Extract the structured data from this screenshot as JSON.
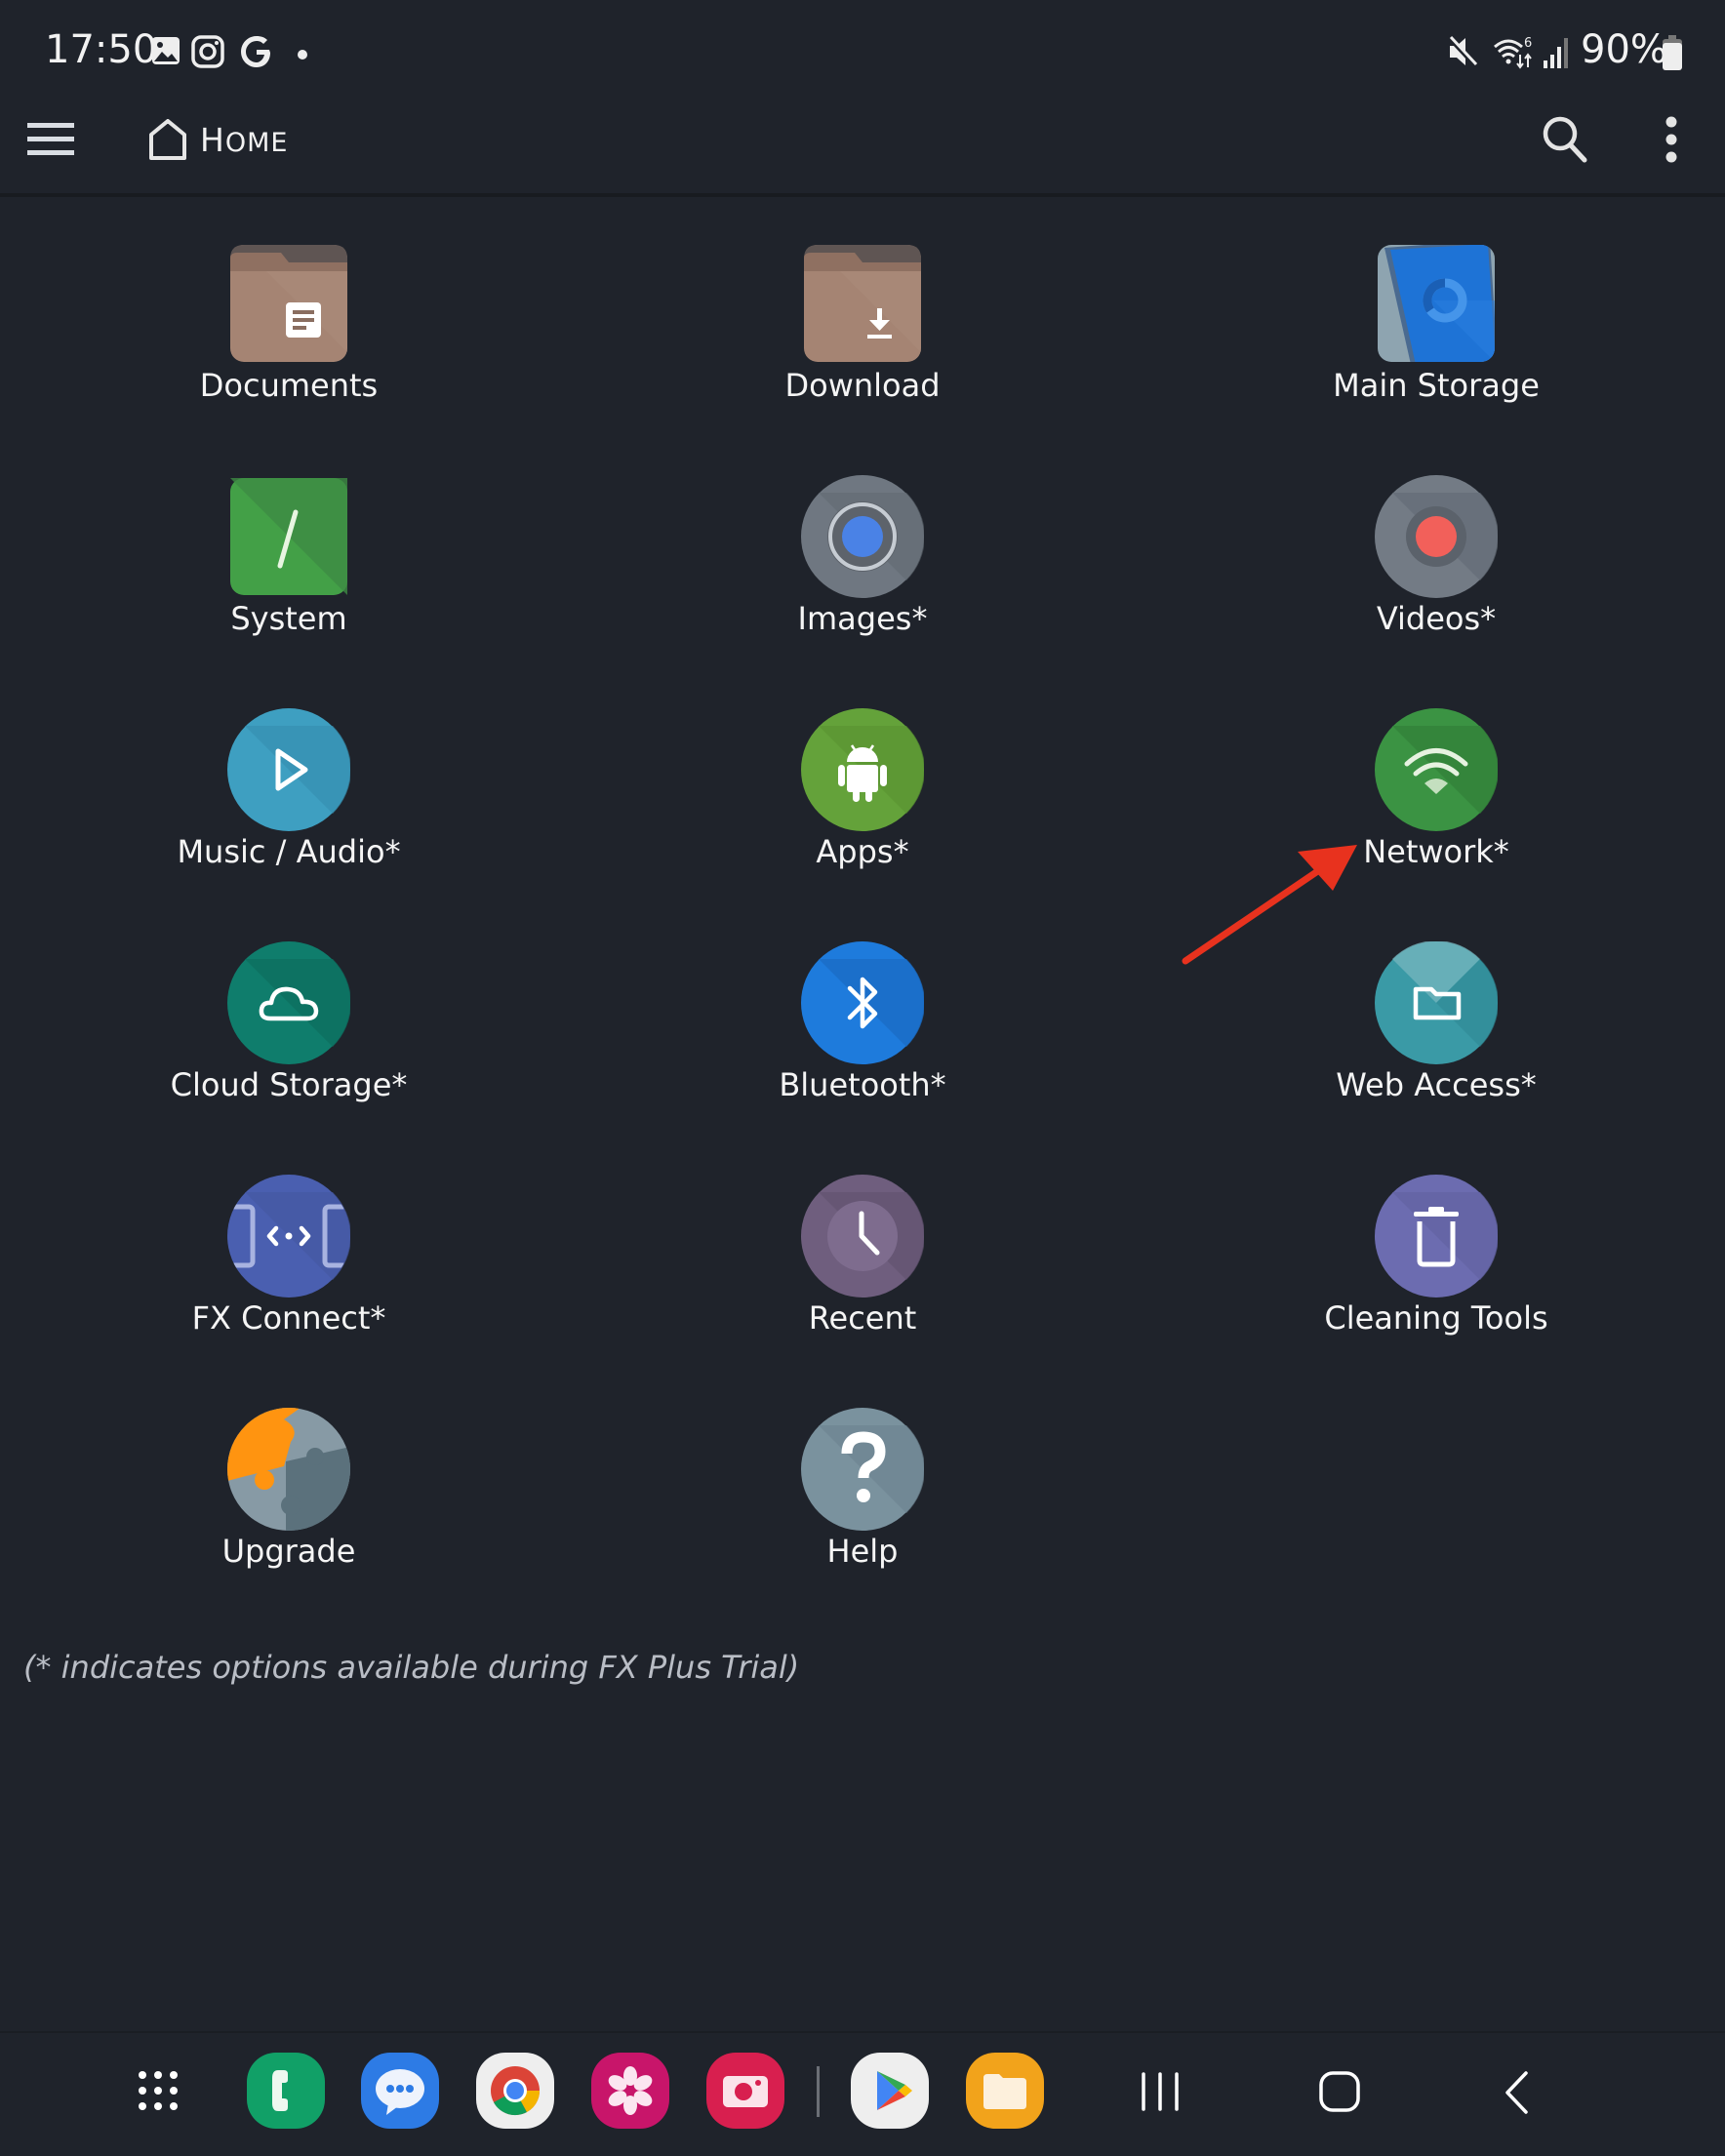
{
  "status_bar": {
    "time": "17:50",
    "left_icons": [
      "gallery-notification-icon",
      "instagram-notification-icon",
      "google-notification-icon",
      "more-notifications-dot"
    ],
    "right_icons": [
      "mute-icon",
      "wifi-6-icon",
      "signal-icon",
      "battery-icon"
    ],
    "battery": "90%"
  },
  "header": {
    "title": "HOME",
    "title_first": "H",
    "title_rest": "OME",
    "menu_icon": "hamburger-icon",
    "home_icon": "home-icon",
    "search_icon": "search-icon",
    "overflow_icon": "more-vert-icon"
  },
  "grid": {
    "items": [
      {
        "label": "Documents",
        "icon": "documents-folder-icon",
        "color": "#a58473"
      },
      {
        "label": "Download",
        "icon": "download-folder-icon",
        "color": "#a58473"
      },
      {
        "label": "Main Storage",
        "icon": "main-storage-icon",
        "color": "#1e73d6"
      },
      {
        "label": "System",
        "icon": "system-root-icon",
        "color": "#43a047"
      },
      {
        "label": "Images*",
        "icon": "images-icon",
        "color": "#6f7781"
      },
      {
        "label": "Videos*",
        "icon": "videos-icon",
        "color": "#737b85"
      },
      {
        "label": "Music / Audio*",
        "icon": "music-play-icon",
        "color": "#3e9fc1"
      },
      {
        "label": "Apps*",
        "icon": "android-apps-icon",
        "color": "#64a23a"
      },
      {
        "label": "Network*",
        "icon": "wifi-network-icon",
        "color": "#3b9343"
      },
      {
        "label": "Cloud Storage*",
        "icon": "cloud-icon",
        "color": "#0f7d6c"
      },
      {
        "label": "Bluetooth*",
        "icon": "bluetooth-icon",
        "color": "#1e7bdc"
      },
      {
        "label": "Web Access*",
        "icon": "web-access-folder-icon",
        "color": "#3a9aa6"
      },
      {
        "label": "FX Connect*",
        "icon": "fx-connect-icon",
        "color": "#4a5fb0"
      },
      {
        "label": "Recent",
        "icon": "clock-icon",
        "color": "#6f5e7e"
      },
      {
        "label": "Cleaning Tools",
        "icon": "trash-icon",
        "color": "#6c6cb0"
      },
      {
        "label": "Upgrade",
        "icon": "puzzle-icon",
        "color": "#879aa5"
      },
      {
        "label": "Help",
        "icon": "help-question-icon",
        "color": "#7a929e"
      }
    ]
  },
  "footnote": "(* indicates options available during FX Plus Trial)",
  "annotation": {
    "type": "red-arrow",
    "points_to": "Network*",
    "color": "#e8321e"
  },
  "dock": {
    "apps": [
      {
        "name": "Phone",
        "icon": "phone-app-icon",
        "color": "#11a067"
      },
      {
        "name": "Messages",
        "icon": "messages-app-icon",
        "color": "#2d7be5"
      },
      {
        "name": "Chrome",
        "icon": "chrome-app-icon",
        "color": "#eeeeee"
      },
      {
        "name": "Blossom",
        "icon": "blossom-app-icon",
        "color": "#c8156a"
      },
      {
        "name": "Camera",
        "icon": "camera-app-icon",
        "color": "#d81f4f"
      },
      {
        "name": "Play Store",
        "icon": "play-store-app-icon",
        "color": "#eeeeee"
      },
      {
        "name": "My Files",
        "icon": "files-app-icon",
        "color": "#f2a31b"
      }
    ],
    "apps_drawer_icon": "app-grid-icon"
  },
  "nav": {
    "recents_icon": "recents-icon",
    "home_icon": "nav-home-icon",
    "back_icon": "back-icon"
  }
}
